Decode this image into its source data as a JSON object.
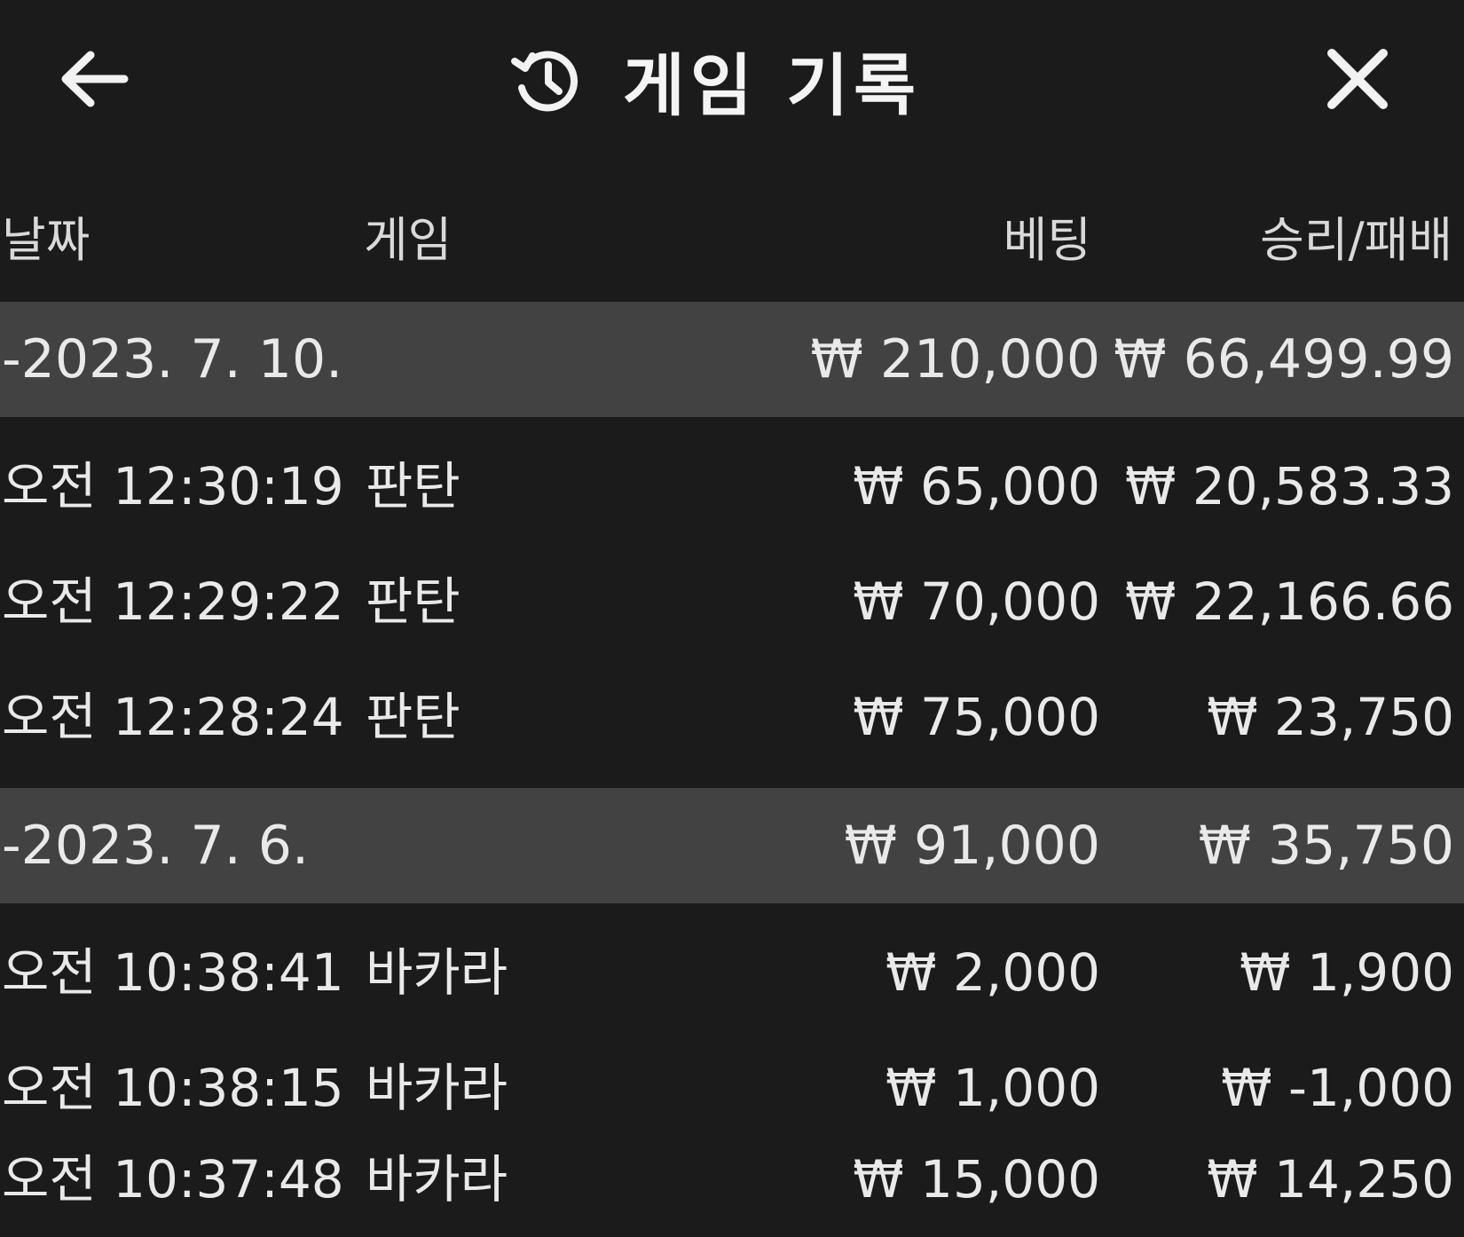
{
  "header": {
    "title": "게임 기록",
    "back_icon": "arrow-left-icon",
    "history_icon": "history-icon",
    "close_icon": "close-icon"
  },
  "columns": {
    "date": "날짜",
    "game": "게임",
    "bet": "베팅",
    "result": "승리/패배"
  },
  "groups": [
    {
      "date": "-2023. 7. 10.",
      "bet_total": "₩ 210,000",
      "result_total": "₩ 66,499.99",
      "rows": [
        {
          "time": "오전 12:30:19",
          "game": "판탄",
          "bet": "₩ 65,000",
          "result": "₩ 20,583.33"
        },
        {
          "time": "오전 12:29:22",
          "game": "판탄",
          "bet": "₩ 70,000",
          "result": "₩ 22,166.66"
        },
        {
          "time": "오전 12:28:24",
          "game": "판탄",
          "bet": "₩ 75,000",
          "result": "₩ 23,750"
        }
      ]
    },
    {
      "date": "-2023. 7. 6.",
      "bet_total": "₩ 91,000",
      "result_total": "₩ 35,750",
      "rows": [
        {
          "time": "오전 10:38:41",
          "game": "바카라",
          "bet": "₩ 2,000",
          "result": "₩ 1,900"
        },
        {
          "time": "오전 10:38:15",
          "game": "바카라",
          "bet": "₩ 1,000",
          "result": "₩ -1,000"
        },
        {
          "time": "오전 10:37:48",
          "game": "바카라",
          "bet": "₩ 15,000",
          "result": "₩ 14,250"
        }
      ]
    }
  ],
  "colors": {
    "background": "#1b1b1b",
    "group_row": "#424242",
    "text": "#e9e9e9"
  }
}
